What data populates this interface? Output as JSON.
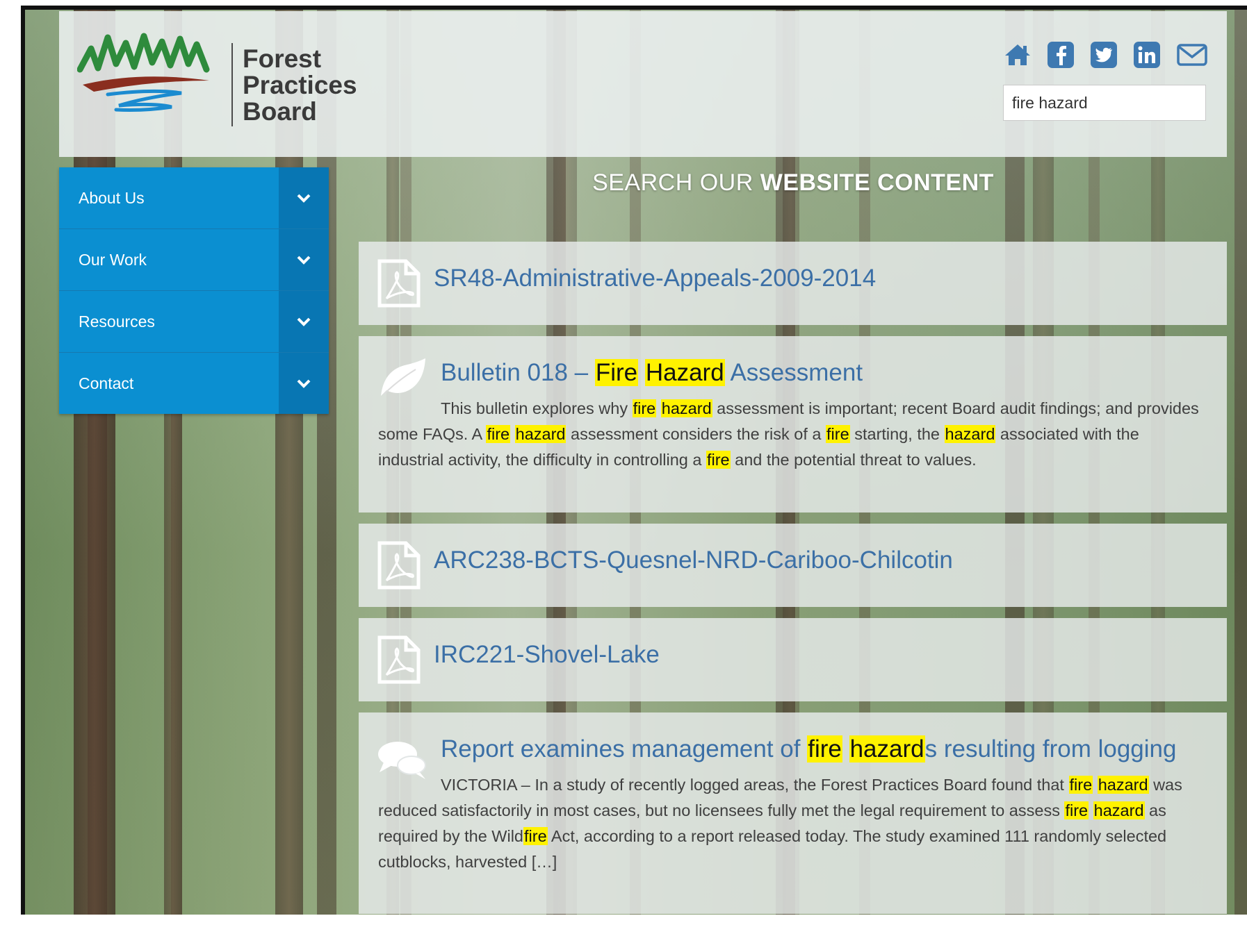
{
  "site": {
    "logo_lines": [
      "Forest",
      "Practices",
      "Board"
    ]
  },
  "header": {
    "social_icons": [
      "home-icon",
      "facebook-icon",
      "twitter-icon",
      "linkedin-icon",
      "email-icon"
    ],
    "search_value": "fire hazard"
  },
  "nav": {
    "items": [
      {
        "label": "About Us"
      },
      {
        "label": "Our Work"
      },
      {
        "label": "Resources"
      },
      {
        "label": "Contact"
      }
    ]
  },
  "section": {
    "title_light": "SEARCH OUR ",
    "title_bold": "WEBSITE CONTENT"
  },
  "results": [
    {
      "icon": "pdf-icon",
      "title": "SR48-Administrative-Appeals-2009-2014"
    },
    {
      "icon": "leaf-icon",
      "title_prefix": "Bulletin 018 – ",
      "title_hl1": "Fire",
      "title_hl2": "Hazard",
      "title_suffix": " Assessment",
      "body": [
        "This bulletin explores why ",
        "fire",
        " ",
        "hazard",
        " assessment is important; recent Board audit findings; and provides some FAQs. A ",
        "fire",
        " ",
        "hazard",
        " assessment considers the risk of a ",
        "fire",
        " starting, the ",
        "hazard",
        " associated with the industrial activity, the difficulty in controlling a ",
        "fire",
        " and the potential threat to values."
      ]
    },
    {
      "icon": "pdf-icon",
      "title": "ARC238-BCTS-Quesnel-NRD-Cariboo-Chilcotin"
    },
    {
      "icon": "pdf-icon",
      "title": "IRC221-Shovel-Lake"
    },
    {
      "icon": "chat-icon",
      "title_prefix": "Report examines management of ",
      "title_hl1": "fire",
      "title_hl2": "hazard",
      "title_suffix": "s resulting from logging",
      "body": [
        "VICTORIA – In a study of recently logged areas, the Forest Practices Board found that ",
        "fire",
        " ",
        "hazard",
        " was reduced satisfactorily in most cases, but no licensees fully met the legal requirement to assess ",
        "fire",
        " ",
        "hazard",
        " as required by the Wild",
        "fire",
        " Act, according to a report released today. The study examined 111 randomly selected cutblocks, harvested […]"
      ]
    }
  ]
}
